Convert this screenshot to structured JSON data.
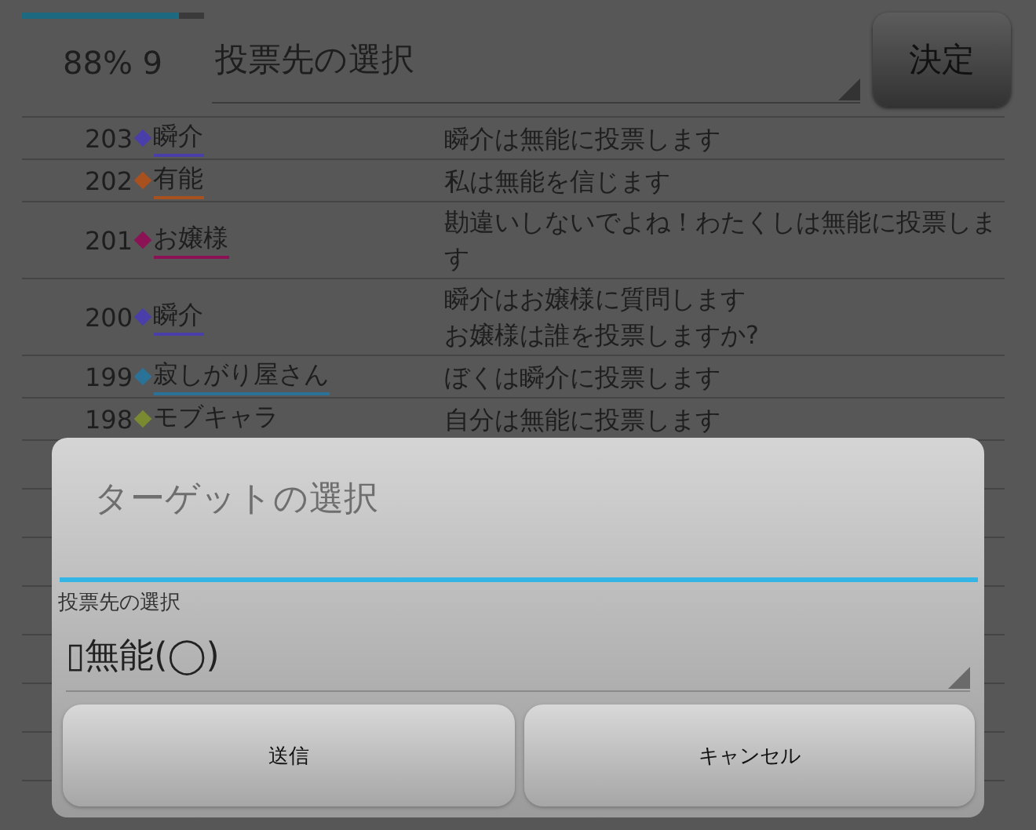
{
  "header": {
    "progress": {
      "level": 0.86
    },
    "status": "88% 9",
    "vote_select": {
      "value": "投票先の選択"
    },
    "decide_button": "決定"
  },
  "log": [
    {
      "number": "203",
      "name": "瞬介",
      "color": "#4a3fa8",
      "linked": true,
      "message": [
        "瞬介は無能に投票します"
      ]
    },
    {
      "number": "202",
      "name": "有能",
      "color": "#a8501e",
      "linked": true,
      "message": [
        "私は無能を信じます"
      ]
    },
    {
      "number": "201",
      "name": "お嬢様",
      "color": "#8c1256",
      "linked": true,
      "message": [
        "勘違いしないでよね！わたくしは無能に投票します"
      ]
    },
    {
      "number": "200",
      "name": "瞬介",
      "color": "#4a3fa8",
      "linked": true,
      "message": [
        "瞬介はお嬢様に質問します",
        "お嬢様は誰を投票しますか?"
      ]
    },
    {
      "number": "199",
      "name": "寂しがり屋さん",
      "color": "#2a7298",
      "linked": true,
      "message": [
        "ぼくは瞬介に投票します"
      ]
    },
    {
      "number": "198",
      "name": "モブキャラ",
      "color": "#7a8a30",
      "linked": false,
      "message": [
        "自分は無能に投票します"
      ]
    }
  ],
  "dialog": {
    "title_field": {
      "placeholder": "ターゲットの選択"
    },
    "label": "投票先の選択",
    "target_select": {
      "value": "▯無能(◯)"
    },
    "buttons": [
      "送信",
      "キャンセル"
    ]
  }
}
